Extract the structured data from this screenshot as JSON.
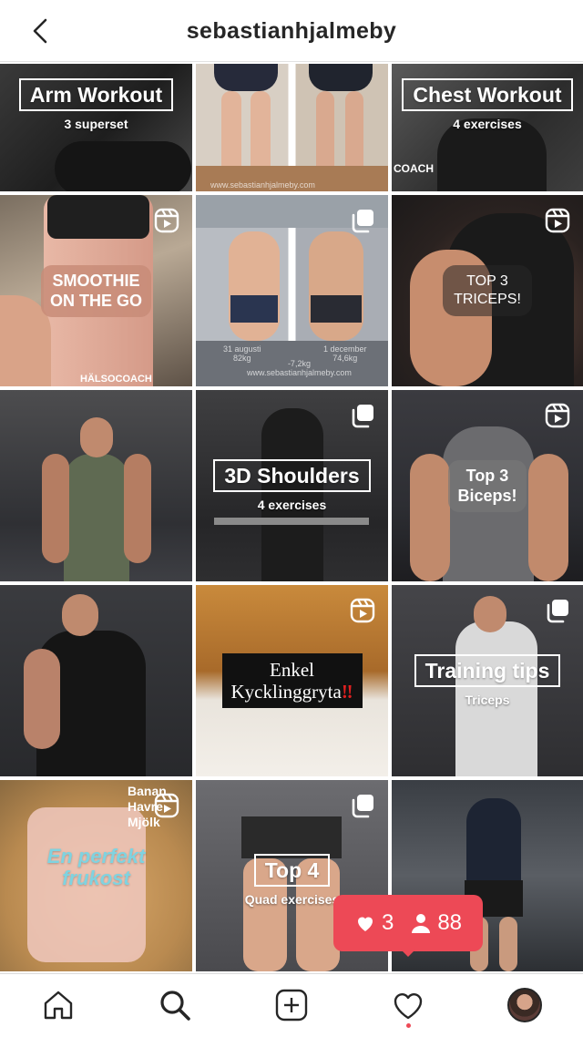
{
  "header": {
    "username": "sebastianhjalmeby",
    "back_icon": "chevron-left-icon"
  },
  "posts": [
    {
      "kind": "arm",
      "title": "Arm Workout",
      "subtitle": "3 superset",
      "type": "none"
    },
    {
      "kind": "legs",
      "watermark": "www.sebastianhjalmeby.com",
      "type": "none"
    },
    {
      "kind": "chest",
      "title": "Chest Workout",
      "subtitle": "4 exercises",
      "corner_text": "COACH",
      "type": "none"
    },
    {
      "kind": "smoothie",
      "title": "SMOOTHIE\nON THE GO",
      "bottom_text": "HÄLSOCOACH",
      "type": "reel"
    },
    {
      "kind": "transform",
      "caption_left": "31 augusti\n82kg",
      "caption_right": "1 december\n74,6kg",
      "caption_center": "-7,2kg\nwww.sebastianhjalmeby.com",
      "type": "carousel"
    },
    {
      "kind": "triceps",
      "title": "TOP 3\nTRICEPS!",
      "type": "reel"
    },
    {
      "kind": "gym",
      "type": "none"
    },
    {
      "kind": "shoulders",
      "title": "3D Shoulders",
      "subtitle": "4 exercises",
      "type": "carousel"
    },
    {
      "kind": "biceps",
      "title": "Top 3\nBiceps!",
      "type": "reel"
    },
    {
      "kind": "phone",
      "type": "none"
    },
    {
      "kind": "food",
      "title": "Enkel\nKycklinggryta",
      "type": "reel"
    },
    {
      "kind": "tips",
      "title": "Training tips",
      "subtitle": "Triceps",
      "type": "carousel"
    },
    {
      "kind": "breakfast",
      "title": "En perfekt\nfrukost",
      "top_text": "Banan\nHavre\nMjölk",
      "type": "reel"
    },
    {
      "kind": "quad",
      "title": "Top 4",
      "subtitle": "Quad exercises",
      "type": "carousel"
    },
    {
      "kind": "run",
      "type": "none"
    }
  ],
  "notification": {
    "likes": "3",
    "follows": "88",
    "color": "#ed4956"
  },
  "nav": {
    "items": [
      "home-icon",
      "search-icon",
      "add-post-icon",
      "activity-heart-icon",
      "profile-avatar"
    ]
  }
}
